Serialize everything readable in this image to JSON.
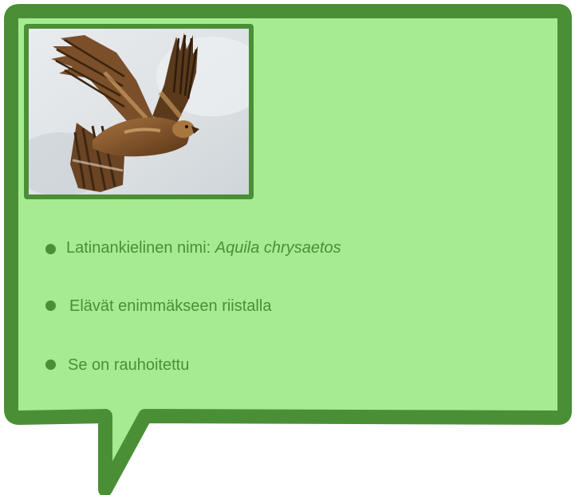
{
  "colors": {
    "panel_fill": "#a6eb91",
    "panel_border": "#4a8f36",
    "text": "#4a8f36"
  },
  "photo": {
    "icon": "eagle-photo",
    "subject": "eagle"
  },
  "facts": [
    {
      "label": "Latinankielinen nimi: ",
      "latin": "Aquila chrysaetos"
    },
    {
      "label": "Elävät enimmäkseen riistalla"
    },
    {
      "label": "Se on rauhoitettu"
    }
  ]
}
